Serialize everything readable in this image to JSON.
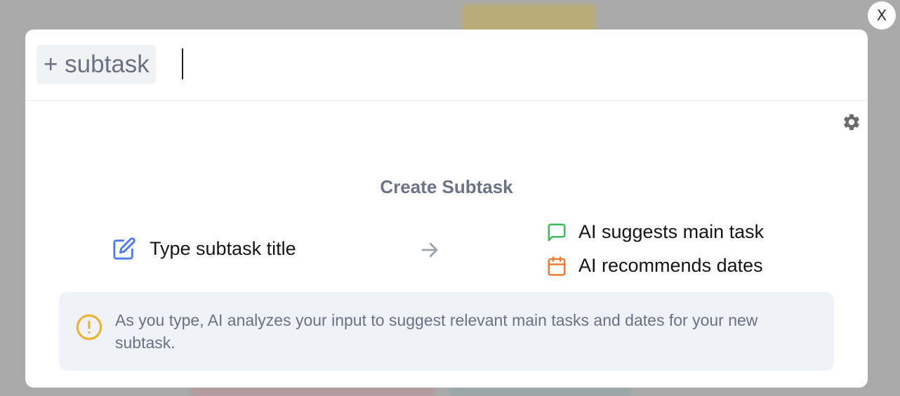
{
  "close_button": {
    "label": "X"
  },
  "composer": {
    "chip_label": "+ subtask",
    "input_value": "",
    "input_placeholder": ""
  },
  "panel": {
    "title": "Create Subtask",
    "steps": {
      "type": {
        "label": "Type subtask title",
        "icon": "edit-icon",
        "color": "#4b7bec"
      },
      "arrow_icon": "arrow-right-icon",
      "main_task": {
        "label": "AI suggests main task",
        "icon": "chat-bubble-icon",
        "color": "#3dbb5c"
      },
      "dates": {
        "label": "AI recommends dates",
        "icon": "calendar-icon",
        "color": "#ee7a31"
      }
    },
    "info": {
      "icon": "exclamation-circle-icon",
      "icon_color": "#ecb23a",
      "text": "As you type, AI analyzes your input to suggest relevant main tasks and dates for your new subtask."
    },
    "settings_icon": "gear-icon"
  },
  "colors": {
    "overlay": "#aaaaaa",
    "modal_bg": "#ffffff",
    "info_bg": "#eff2f8",
    "muted_text": "#6a7282"
  }
}
